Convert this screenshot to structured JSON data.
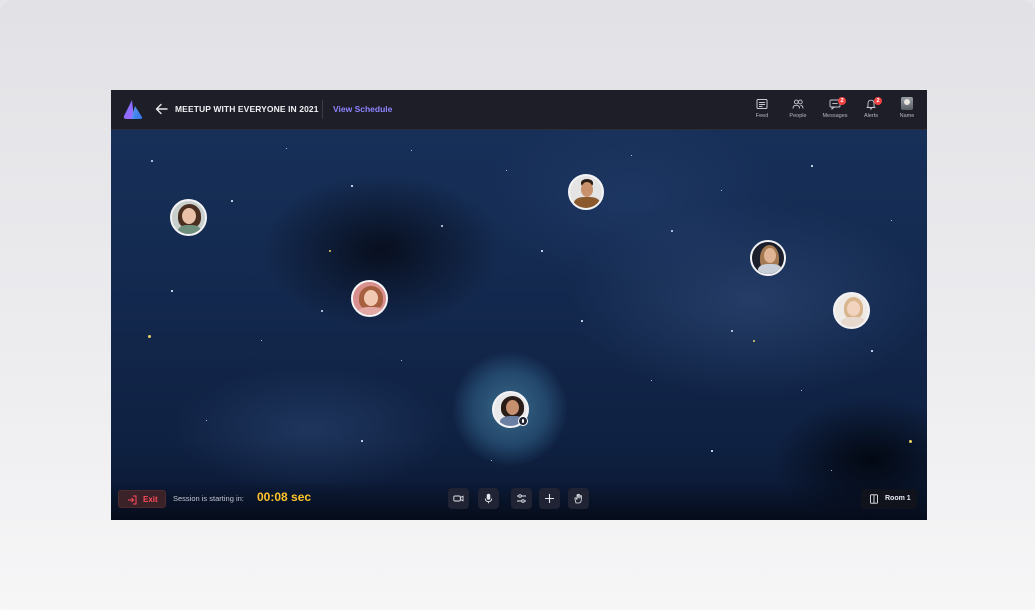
{
  "header": {
    "title": "MEETUP WITH EVERYONE IN 2021",
    "schedule_link": "View Schedule",
    "nav": [
      {
        "label": "Feed",
        "icon": "feed-icon"
      },
      {
        "label": "People",
        "icon": "people-icon"
      },
      {
        "label": "Messages",
        "icon": "messages-icon",
        "badge": "2"
      },
      {
        "label": "Alerts",
        "icon": "bell-icon",
        "badge": "2"
      },
      {
        "label": "Name",
        "icon": "user-avatar"
      }
    ]
  },
  "footer": {
    "exit_label": "Exit",
    "session_text": "Session is starting in:",
    "countdown": "00:08 sec",
    "controls": [
      "camera-icon",
      "microphone-icon",
      "settings-sliders-icon",
      "plus-icon",
      "hand-raise-icon"
    ],
    "room_label": "Room 1"
  },
  "colors": {
    "accent_link": "#8f83ff",
    "countdown": "#ffc52a",
    "exit": "#ff4b5c",
    "badge": "#f24343"
  }
}
